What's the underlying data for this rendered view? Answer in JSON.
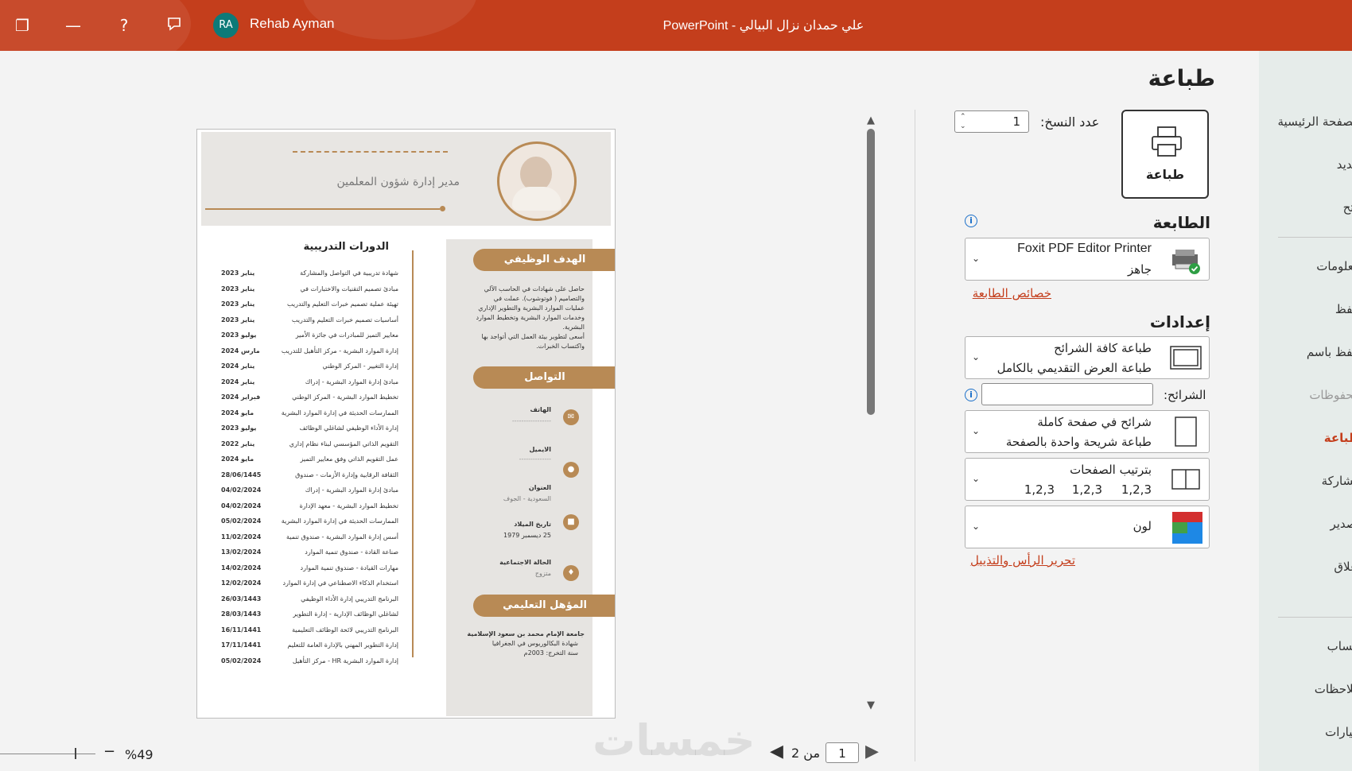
{
  "titlebar": {
    "user_initials": "RA",
    "user_name": "Rehab Ayman",
    "document_title": "علي حمدان نزال البيالي  -  PowerPoint",
    "icons": [
      "restore-icon",
      "minimize-icon",
      "help-icon",
      "comments-icon"
    ],
    "color": "#c43e1c"
  },
  "page_heading": "طباعة",
  "nav": {
    "items": [
      "الصفحة الرئيسية",
      "جديد",
      "فتح",
      "معلومات",
      "حفظ",
      "حفظ باسم",
      "محفوظات",
      "طباعة",
      "مشاركة",
      "تصدير",
      "إغلاق",
      "حساب",
      "ملاحظات",
      "خيارات"
    ],
    "active": "طباعة"
  },
  "print": {
    "button_label": "طباعة",
    "copies_label": "عدد النسخ:",
    "copies_value": "1"
  },
  "printer": {
    "section_title": "الطابعة",
    "name": "Foxit PDF Editor Printer",
    "status": "جاهز",
    "properties_link": "خصائص الطابعة"
  },
  "settings": {
    "section_title": "إعدادات",
    "slides_option_title": "طباعة كافة الشرائح",
    "slides_option_desc": "طباعة العرض التقديمي بالكامل",
    "slides_label": "الشرائح:",
    "slides_value": "",
    "layout_title": "شرائح في صفحة كاملة",
    "layout_desc": "طباعة شريحة واحدة بالصفحة",
    "collation_title": "بترتيب الصفحات",
    "collation_values": [
      "1,2,3",
      "1,2,3",
      "1,2,3"
    ],
    "color_option": "لون",
    "header_footer_link": "تحرير الرأس والتذييل"
  },
  "preview": {
    "current_page": "1",
    "of_pages": "من 2",
    "zoom": "%49",
    "watermark": "خمسات"
  },
  "cv": {
    "job_title": "مدير إدارة شؤون المعلمين",
    "section_objective": "الهدف الوظيفي",
    "objective_lines": [
      "حاصل على شهادات في الحاسب الآلي",
      "والتصاميم ( فوتوشوب). عملت في",
      "عمليات الموارد البشرية والتطوير الإداري",
      "وخدمات الموارد البشرية وتخطيط الموارد",
      "البشرية.",
      "أسعى لتطوير بيئة العمل التي أتواجد بها",
      "واكتساب الخبرات."
    ],
    "section_contact": "التواصل",
    "contact": [
      {
        "label": "الهاتف",
        "value": "-----------------"
      },
      {
        "label": "الايميل",
        "value": "--------------"
      },
      {
        "label": "العنوان",
        "value": "السعودية - الجوف"
      },
      {
        "label": "تاريخ الميلاد",
        "value": "25 ديسمبر 1979"
      },
      {
        "label": "الحالة الاجتماعية",
        "value": "متزوج"
      }
    ],
    "section_education": "المؤهل التعليمي",
    "education_lines": [
      "جامعة الإمام محمد بن سعود الإسلامية",
      "شهادة البكالوريوس في الجغرافيا",
      "سنة التخرج: 2003م"
    ],
    "section_courses": "الدورات التدريبية",
    "courses": [
      {
        "date": "يناير 2023",
        "text": "شهادة تدريبية في التواصل والمشاركة"
      },
      {
        "date": "يناير 2023",
        "text": "مبادئ تصميم التقنيات والاختبارات في"
      },
      {
        "date": "يناير 2023",
        "text": "تهيئة عملية تصميم خبرات التعليم والتدريب"
      },
      {
        "date": "يناير 2023",
        "text": "أساسيات تصميم خبرات التعليم والتدريب"
      },
      {
        "date": "يوليو 2023",
        "text": "معايير التميز للمبادرات في جائزة الأمير"
      },
      {
        "date": "مارس 2024",
        "text": "إدارة الموارد البشرية - مركز التأهيل للتدريب"
      },
      {
        "date": "يناير 2024",
        "text": "إدارة التغيير - المركز الوطني"
      },
      {
        "date": "يناير 2024",
        "text": "مبادئ إدارة الموارد البشرية - إدراك"
      },
      {
        "date": "فبراير 2024",
        "text": "تخطيط الموارد البشرية - المركز الوطني"
      },
      {
        "date": "مايو 2024",
        "text": "الممارسات الحديثة في إدارة الموارد البشرية"
      },
      {
        "date": "يوليو 2023",
        "text": "إدارة الأداء الوظيفي لشاغلي الوظائف"
      },
      {
        "date": "يناير 2022",
        "text": "التقويم الذاتي المؤسسي لبناء نظام إداري"
      },
      {
        "date": "مايو 2024",
        "text": "عمل التقويم الذاتي وفق معايير التميز"
      },
      {
        "date": "28/06/1445",
        "text": "الثقافة الرقابية وإدارة الأزمات - صندوق"
      },
      {
        "date": "04/02/2024",
        "text": "مبادئ إدارة الموارد البشرية - إدراك"
      },
      {
        "date": "04/02/2024",
        "text": "تخطيط الموارد البشرية - معهد الإدارة"
      },
      {
        "date": "05/02/2024",
        "text": "الممارسات الحديثة في إدارة الموارد البشرية"
      },
      {
        "date": "11/02/2024",
        "text": "أسس إدارة الموارد البشرية - صندوق تنمية"
      },
      {
        "date": "13/02/2024",
        "text": "صناعة القادة - صندوق تنمية الموارد"
      },
      {
        "date": "14/02/2024",
        "text": "مهارات القيادة - صندوق تنمية الموارد"
      },
      {
        "date": "12/02/2024",
        "text": "استخدام الذكاء الاصطناعي في إدارة الموارد"
      },
      {
        "date": "26/03/1443",
        "text": "البرنامج التدريبي إدارة الأداء الوظيفي"
      },
      {
        "date": "28/03/1443",
        "text": "لشاغلي الوظائف الإدارية - إدارة التطوير"
      },
      {
        "date": "16/11/1441",
        "text": "البرنامج التدريبي لائحة الوظائف التعليمية"
      },
      {
        "date": "17/11/1441",
        "text": "إدارة التطوير المهني بالإدارة العامة للتعليم"
      },
      {
        "date": "05/02/2024",
        "text": "إدارة الموارد البشرية HR - مركز التأهيل"
      }
    ]
  }
}
